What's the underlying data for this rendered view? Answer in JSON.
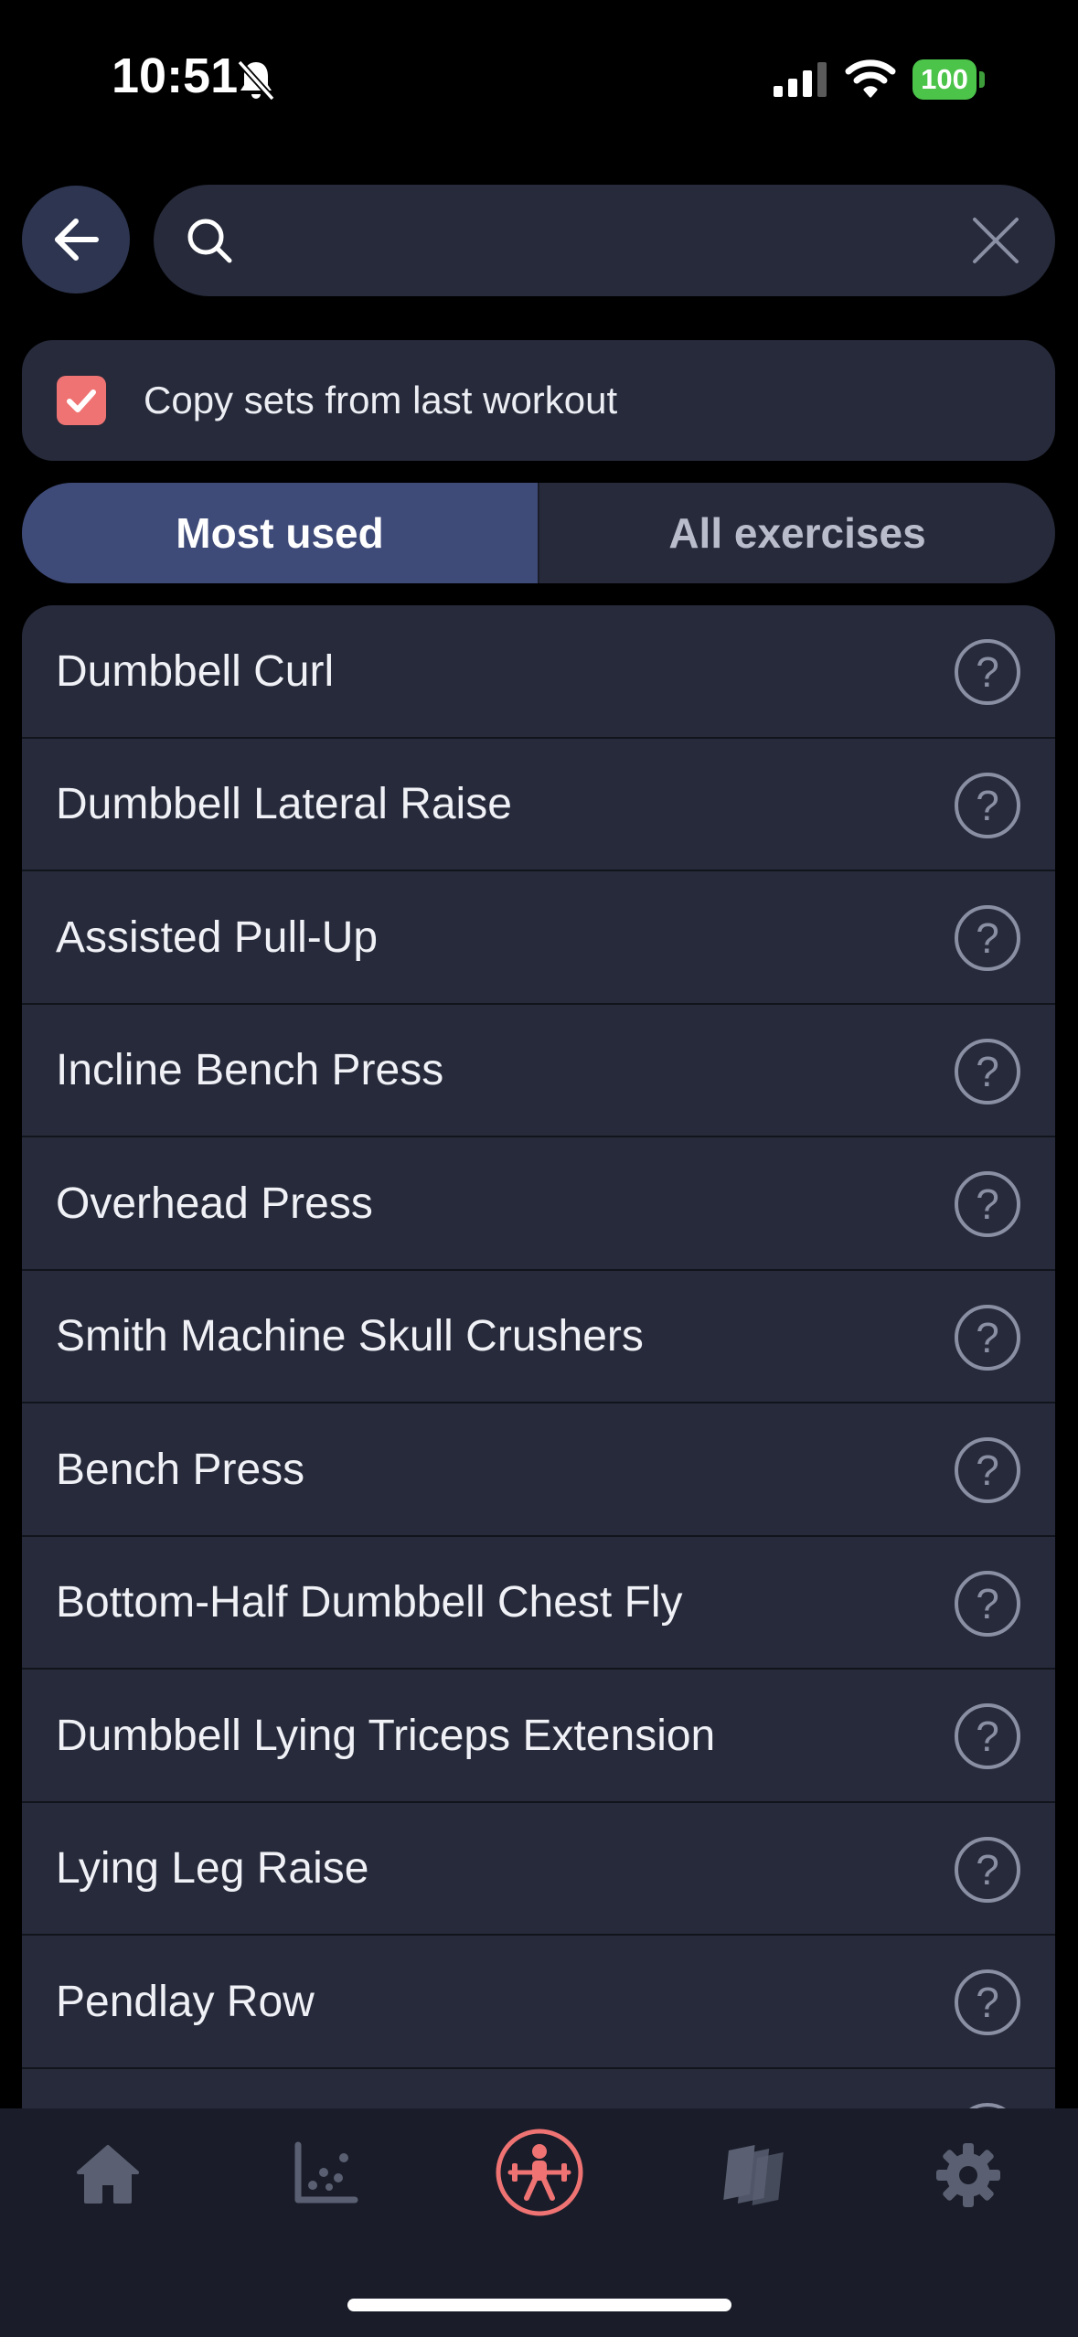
{
  "status_bar": {
    "time": "10:51",
    "battery": "100",
    "icons": [
      "bell-muted-icon",
      "cellular-signal-icon",
      "wifi-icon",
      "battery-icon"
    ]
  },
  "search": {
    "value": "",
    "placeholder": "",
    "icons": [
      "back-arrow-icon",
      "search-icon",
      "clear-icon"
    ]
  },
  "copy_sets": {
    "label": "Copy sets from last workout",
    "checked": true
  },
  "tabs": [
    {
      "label": "Most used",
      "active": true
    },
    {
      "label": "All exercises",
      "active": false
    }
  ],
  "exercises": [
    {
      "name": "Dumbbell Curl"
    },
    {
      "name": "Dumbbell Lateral Raise"
    },
    {
      "name": "Assisted Pull-Up"
    },
    {
      "name": "Incline Bench Press"
    },
    {
      "name": "Overhead Press"
    },
    {
      "name": "Smith Machine Skull Crushers"
    },
    {
      "name": "Bench Press"
    },
    {
      "name": "Bottom-Half Dumbbell Chest Fly"
    },
    {
      "name": "Dumbbell Lying Triceps Extension"
    },
    {
      "name": "Lying Leg Raise"
    },
    {
      "name": "Pendlay Row"
    }
  ],
  "help_glyph": "?",
  "tab_bar": {
    "items": [
      {
        "icon": "home-icon",
        "active": false
      },
      {
        "icon": "scatter-chart-icon",
        "active": false
      },
      {
        "icon": "workout-icon",
        "active": true
      },
      {
        "icon": "library-icon",
        "active": false
      },
      {
        "icon": "gear-icon",
        "active": false
      }
    ]
  },
  "colors": {
    "background": "#000000",
    "surface": "#262a3a",
    "active_tab": "#3e4a78",
    "accent": "#f07373",
    "battery": "#4cc44a",
    "tab_icon": "#5a6072"
  }
}
